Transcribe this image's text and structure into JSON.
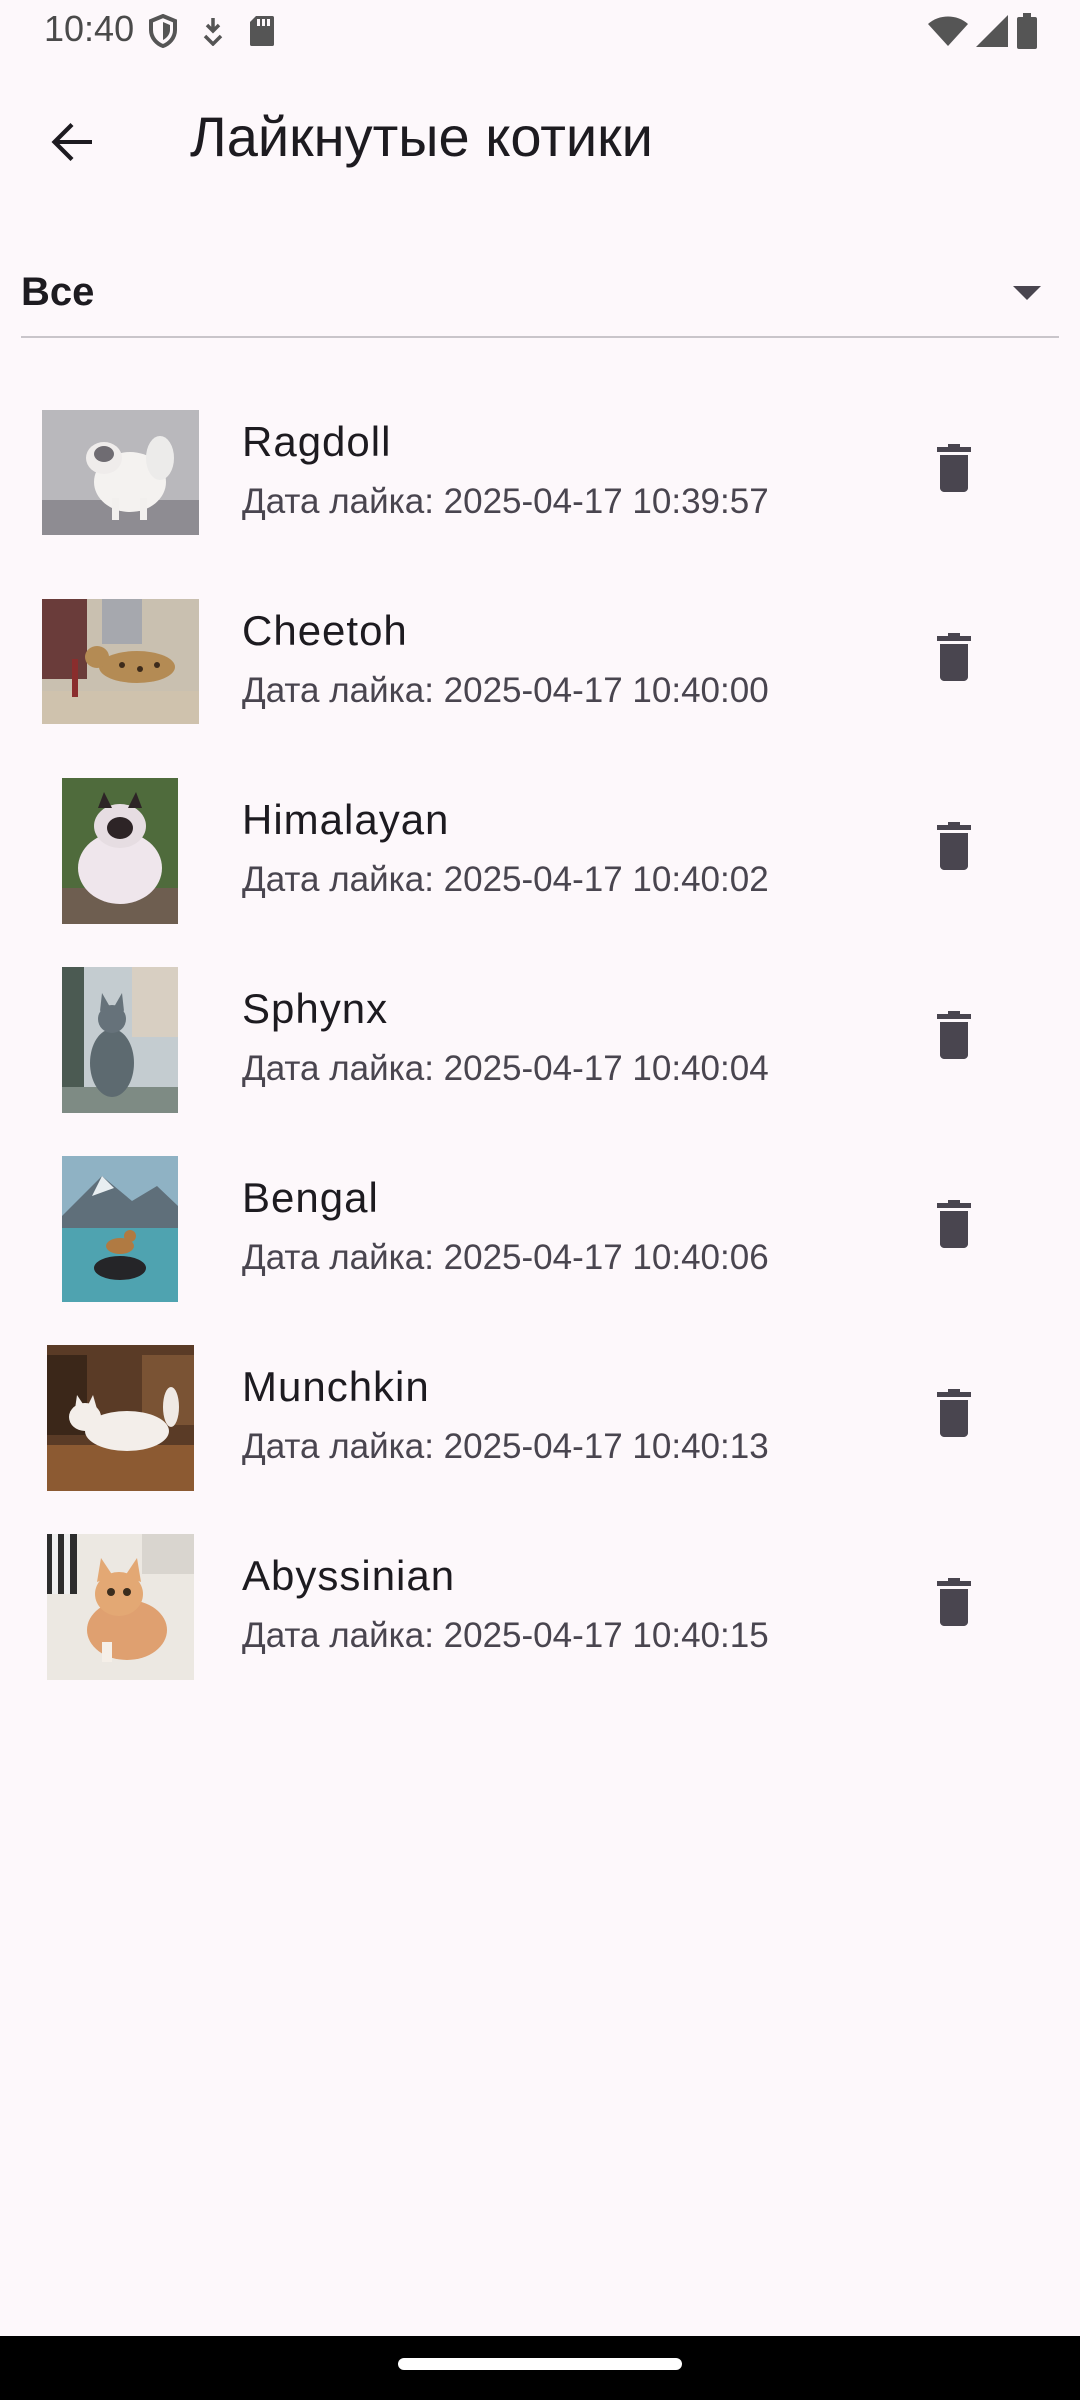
{
  "status_bar": {
    "time": "10:40",
    "icons_left": [
      "shield-icon",
      "download-icon",
      "sd-card-icon"
    ],
    "icons_right": [
      "wifi-icon",
      "signal-icon",
      "battery-icon"
    ]
  },
  "app_bar": {
    "title": "Лайкнутые котики",
    "back_icon": "arrow-back-icon"
  },
  "filter": {
    "selected": "Все",
    "icon": "dropdown-arrow-icon"
  },
  "cats": [
    {
      "breed": "Ragdoll",
      "date": "Дата лайка: 2025-04-17 10:39:57"
    },
    {
      "breed": "Cheetoh",
      "date": "Дата лайка: 2025-04-17 10:40:00"
    },
    {
      "breed": "Himalayan",
      "date": "Дата лайка: 2025-04-17 10:40:02"
    },
    {
      "breed": "Sphynx",
      "date": "Дата лайка: 2025-04-17 10:40:04"
    },
    {
      "breed": "Bengal",
      "date": "Дата лайка: 2025-04-17 10:40:06"
    },
    {
      "breed": "Munchkin",
      "date": "Дата лайка: 2025-04-17 10:40:13"
    },
    {
      "breed": "Abyssinian",
      "date": "Дата лайка: 2025-04-17 10:40:15"
    }
  ],
  "colors": {
    "background": "#fdf8fb",
    "text_primary": "#1d1b20",
    "text_secondary": "#49454f",
    "icon": "#49454f"
  }
}
